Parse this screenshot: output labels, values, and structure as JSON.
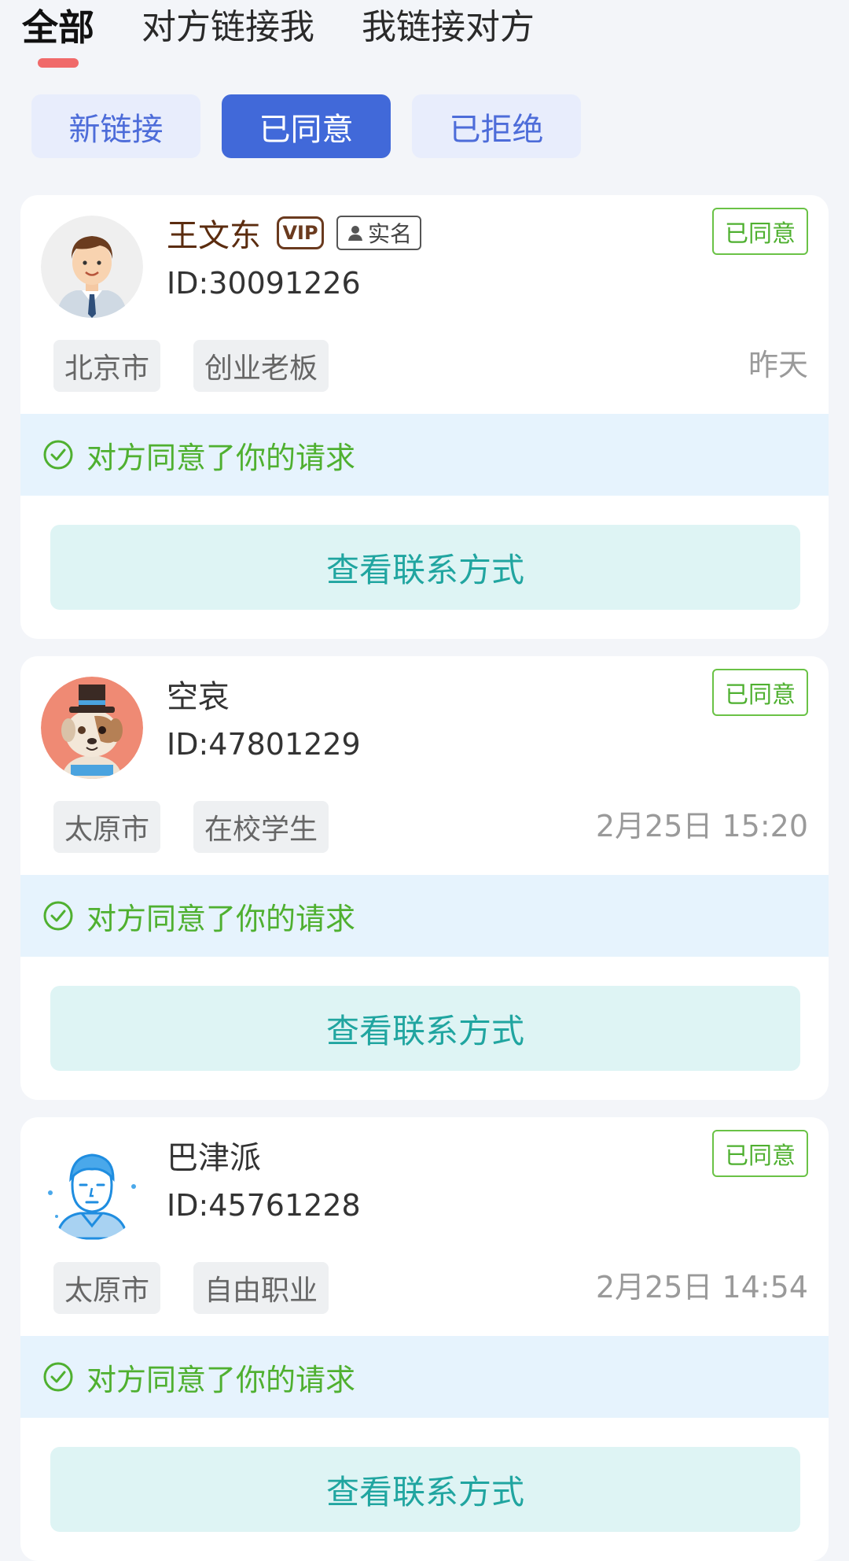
{
  "top_tabs": [
    {
      "label": "全部"
    },
    {
      "label": "对方链接我"
    },
    {
      "label": "我链接对方"
    }
  ],
  "filters": [
    {
      "label": "新链接"
    },
    {
      "label": "已同意"
    },
    {
      "label": "已拒绝"
    }
  ],
  "cards": [
    {
      "name": "王文东",
      "vip_label": "VIP",
      "realname_label": "实名",
      "id": "ID:30091226",
      "status": "已同意",
      "tags": [
        "北京市",
        "创业老板"
      ],
      "time": "昨天",
      "notice": "对方同意了你的请求",
      "button": "查看联系方式"
    },
    {
      "name": "空哀",
      "id": "ID:47801229",
      "status": "已同意",
      "tags": [
        "太原市",
        "在校学生"
      ],
      "time": "2月25日 15:20",
      "notice": "对方同意了你的请求",
      "button": "查看联系方式"
    },
    {
      "name": "巴津派",
      "id": "ID:45761228",
      "status": "已同意",
      "tags": [
        "太原市",
        "自由职业"
      ],
      "time": "2月25日 14:54",
      "notice": "对方同意了你的请求",
      "button": "查看联系方式"
    }
  ],
  "colors": {
    "accent_blue": "#4169d9",
    "status_green": "#4fb030",
    "tab_underline": "#f06a6a",
    "contact_button_text": "#20a5a0"
  }
}
